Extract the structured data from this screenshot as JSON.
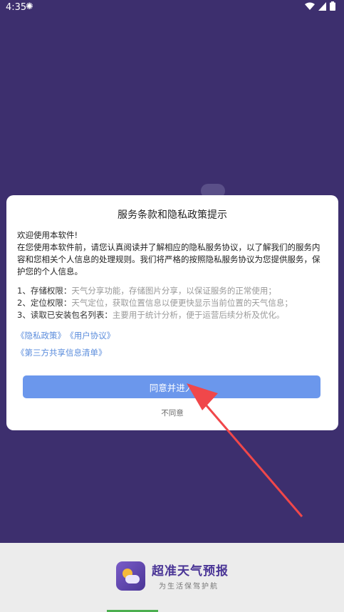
{
  "statusbar": {
    "time": "4:35"
  },
  "dialog": {
    "title": "服务条款和隐私政策提示",
    "greeting": "欢迎使用本软件!",
    "intro": "在您使用本软件前，请您认真阅读并了解相应的隐私服务协议，以了解我们的服务内容和您相关个人信息的处理规则。我们将严格的按照隐私服务协议为您提供服务，保护您的个人信息。",
    "permissions": [
      {
        "label": "1、存储权限：",
        "desc": "天气分享功能，存储图片分享，以保证服务的正常使用；"
      },
      {
        "label": " 2、定位权限：",
        "desc": "天气定位，获取位置信息以便更快显示当前位置的天气信息；"
      },
      {
        "label": " 3、读取已安装包名列表：",
        "desc": "主要用于统计分析，便于运营后续分析及优化。"
      }
    ],
    "links": {
      "privacy": "《隐私政策》",
      "user_agreement": "《用户协议》",
      "third_party": "《第三方共享信息清单》"
    },
    "agree_label": "同意并进入",
    "disagree_label": "不同意"
  },
  "brand": {
    "name": "超准天气预报",
    "slogan": "为生活保驾护航"
  },
  "colors": {
    "background": "#3d2f6e",
    "button": "#6b97ec",
    "link": "#5a8cdc",
    "arrow": "#f0474a"
  }
}
